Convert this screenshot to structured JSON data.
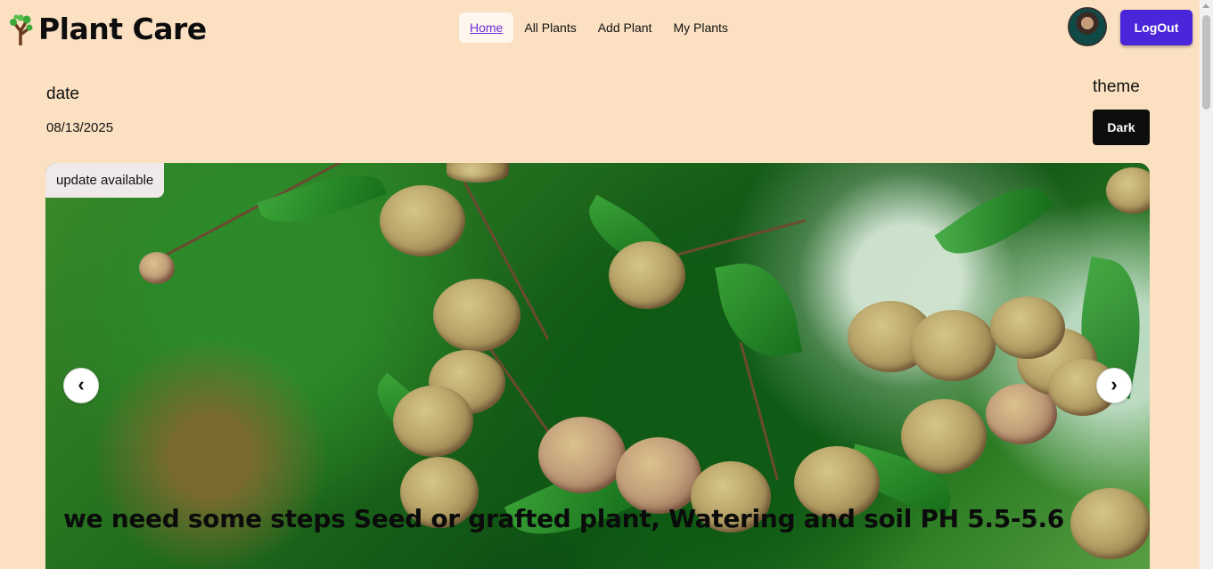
{
  "app": {
    "title": "Plant Care",
    "logo_icon": "tree-icon"
  },
  "nav": {
    "items": [
      {
        "label": "Home",
        "active": true
      },
      {
        "label": "All Plants",
        "active": false
      },
      {
        "label": "Add Plant",
        "active": false
      },
      {
        "label": "My Plants",
        "active": false
      }
    ]
  },
  "header_actions": {
    "logout_label": "LogOut"
  },
  "date_section": {
    "label": "date",
    "value": "08/13/2025"
  },
  "theme_section": {
    "label": "theme",
    "button_label": "Dark"
  },
  "carousel": {
    "badge": "update available",
    "prev_glyph": "‹",
    "next_glyph": "›",
    "caption": "we need some steps Seed or grafted plant, Watering and soil PH 5.5-5.6"
  },
  "colors": {
    "background": "#fbe1c2",
    "logout_button": "#4a25d9",
    "theme_button": "#0e0e0e",
    "active_nav_text": "#6b2fd6"
  }
}
